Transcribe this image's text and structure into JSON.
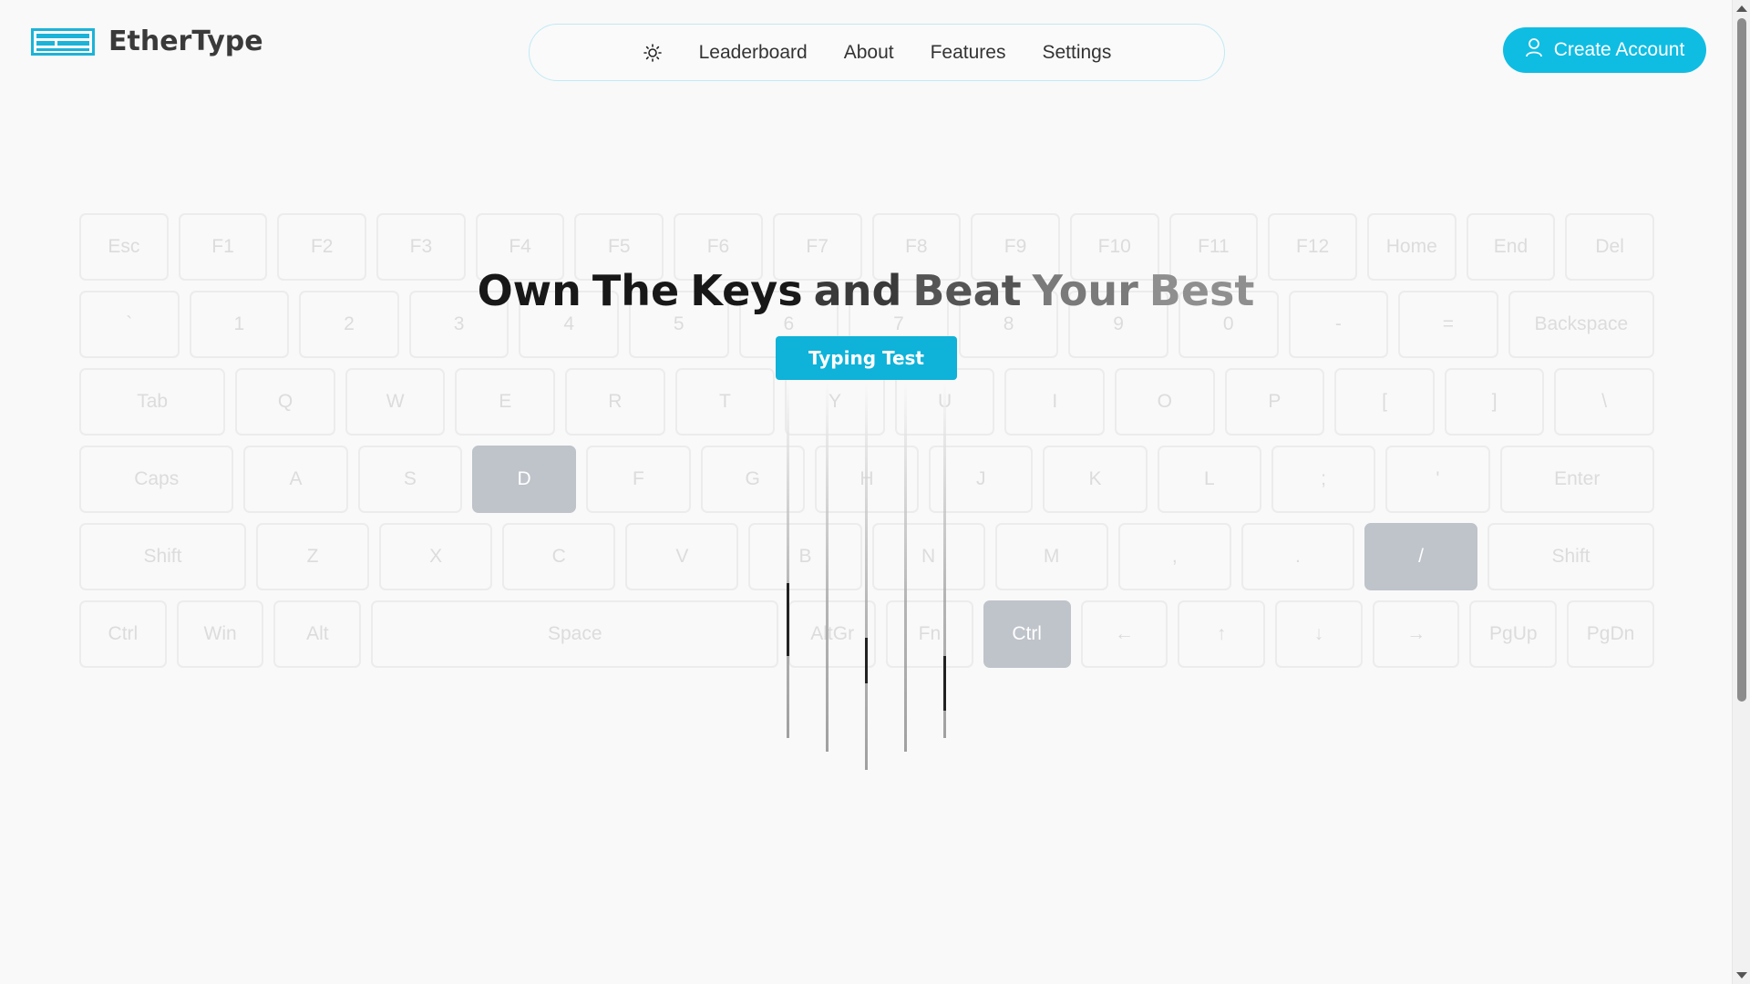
{
  "header": {
    "brand": "EtherType",
    "nav": [
      "Leaderboard",
      "About",
      "Features",
      "Settings"
    ],
    "create_account": "Create Account",
    "theme_icon": "sun-icon",
    "user_icon": "user-icon"
  },
  "hero": {
    "title_words": [
      "Own",
      "The",
      "Keys",
      "and",
      "Beat",
      "Your",
      "Best"
    ],
    "cta": "Typing Test"
  },
  "keyboard": {
    "rows": [
      [
        "Esc",
        "F1",
        "F2",
        "F3",
        "F4",
        "F5",
        "F6",
        "F7",
        "F8",
        "F9",
        "F10",
        "F11",
        "F12",
        "Home",
        "End",
        "Del"
      ],
      [
        "`",
        "1",
        "2",
        "3",
        "4",
        "5",
        "6",
        "7",
        "8",
        "9",
        "0",
        "-",
        "=",
        "Backspace"
      ],
      [
        "Tab",
        "Q",
        "W",
        "E",
        "R",
        "T",
        "Y",
        "U",
        "I",
        "O",
        "P",
        "[",
        "]",
        "\\"
      ],
      [
        "Caps",
        "A",
        "S",
        "D",
        "F",
        "G",
        "H",
        "J",
        "K",
        "L",
        ";",
        "'",
        "Enter"
      ],
      [
        "Shift",
        "Z",
        "X",
        "C",
        "V",
        "B",
        "N",
        "M",
        ",",
        ".",
        "/",
        "Shift"
      ],
      [
        "Ctrl",
        "Win",
        "Alt",
        "Space",
        "AltGr",
        "Fn",
        "Ctrl",
        "←",
        "↑",
        "↓",
        "→",
        "PgUp",
        "PgDn"
      ]
    ],
    "active_keys": [
      "D",
      "/",
      "Ctrl"
    ]
  },
  "colors": {
    "accent": "#0fbde3",
    "button": "#0fb2d8",
    "active_key": "#bfc3ca",
    "key_border": "#ececec",
    "background": "#f9f9f9"
  }
}
